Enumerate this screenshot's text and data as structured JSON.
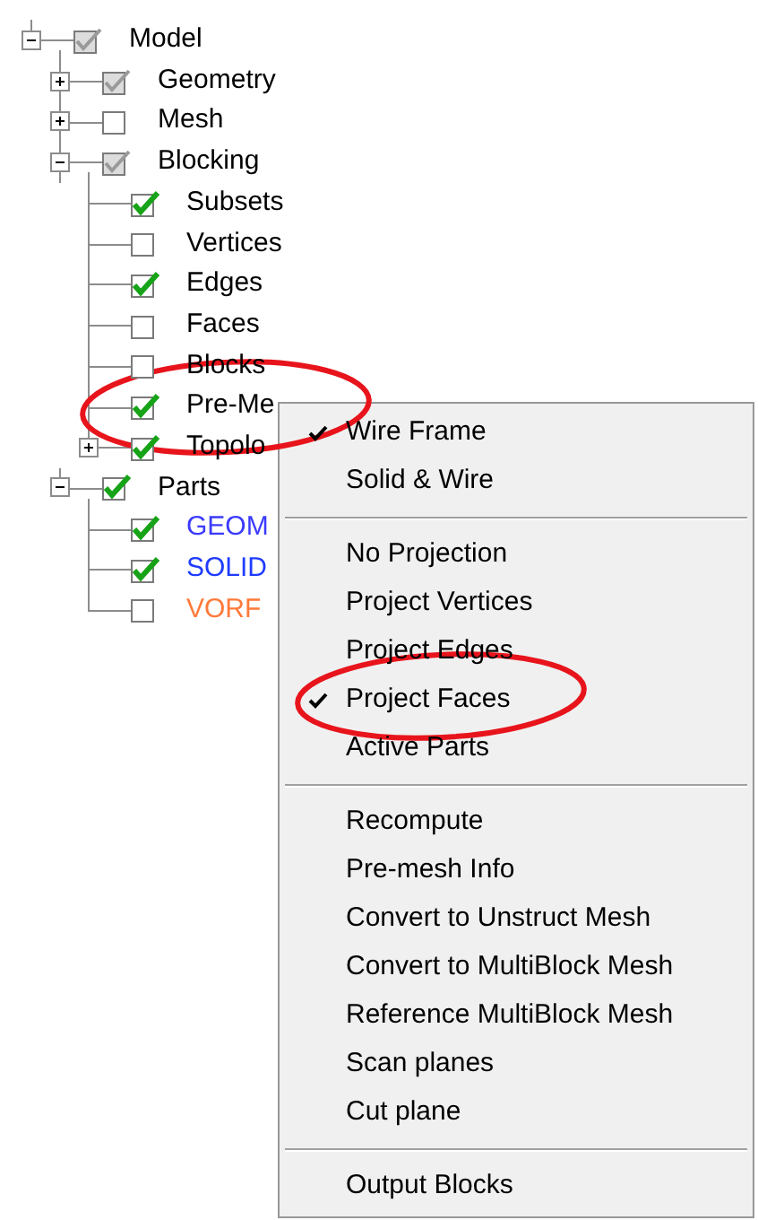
{
  "tree": [
    {
      "label": "Model",
      "checked": true,
      "partial": true,
      "expanded": true,
      "children": [
        {
          "label": "Geometry",
          "checked": true,
          "partial": true,
          "expanded": false
        },
        {
          "label": "Mesh",
          "checked": false,
          "partial": false,
          "expanded": false
        },
        {
          "label": "Blocking",
          "checked": true,
          "partial": true,
          "expanded": true,
          "children": [
            {
              "label": "Subsets",
              "checked": true,
              "partial": false
            },
            {
              "label": "Vertices",
              "checked": false,
              "partial": false
            },
            {
              "label": "Edges",
              "checked": true,
              "partial": false
            },
            {
              "label": "Faces",
              "checked": false,
              "partial": false
            },
            {
              "label": "Blocks",
              "checked": false,
              "partial": false
            },
            {
              "label": "Pre-Me",
              "checked": true,
              "partial": false
            },
            {
              "label": "Topolo",
              "checked": true,
              "partial": false,
              "expanded": false
            }
          ]
        },
        {
          "label": "Parts",
          "checked": true,
          "partial": false,
          "expanded": true,
          "children": [
            {
              "label": "GEOM",
              "checked": true,
              "partial": false,
              "color": "#3b3bff"
            },
            {
              "label": "SOLID",
              "checked": true,
              "partial": false,
              "color": "#1f3cff"
            },
            {
              "label": "VORF",
              "checked": false,
              "partial": false,
              "color": "#ff7a3a"
            }
          ]
        }
      ]
    }
  ],
  "context_menu": [
    {
      "kind": "item",
      "label": "Wire Frame",
      "checked": true
    },
    {
      "kind": "item",
      "label": "Solid & Wire",
      "checked": false
    },
    {
      "kind": "separator"
    },
    {
      "kind": "item",
      "label": "No Projection",
      "checked": false
    },
    {
      "kind": "item",
      "label": "Project Vertices",
      "checked": false
    },
    {
      "kind": "item",
      "label": "Project Edges",
      "checked": false
    },
    {
      "kind": "item",
      "label": "Project Faces",
      "checked": true
    },
    {
      "kind": "item",
      "label": "Active Parts",
      "checked": false
    },
    {
      "kind": "separator"
    },
    {
      "kind": "item",
      "label": "Recompute"
    },
    {
      "kind": "item",
      "label": "Pre-mesh Info"
    },
    {
      "kind": "item",
      "label": "Convert to Unstruct Mesh"
    },
    {
      "kind": "item",
      "label": "Convert to MultiBlock Mesh"
    },
    {
      "kind": "item",
      "label": "Reference MultiBlock Mesh"
    },
    {
      "kind": "item",
      "label": "Scan planes"
    },
    {
      "kind": "item",
      "label": "Cut plane"
    },
    {
      "kind": "separator"
    },
    {
      "kind": "item",
      "label": "Output Blocks"
    }
  ]
}
